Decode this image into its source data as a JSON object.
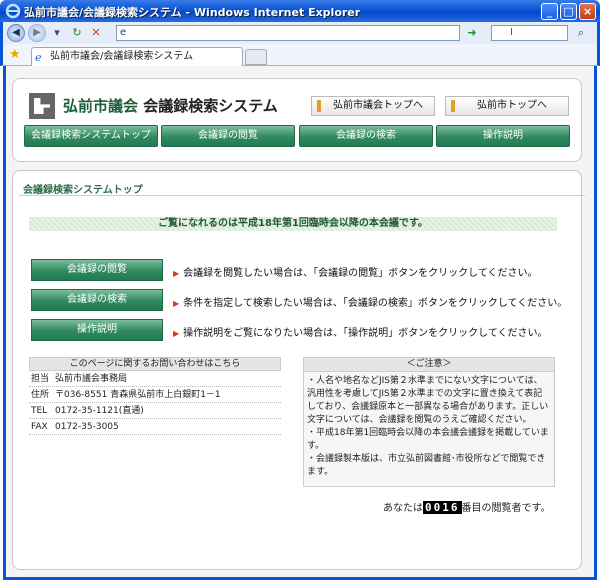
{
  "window": {
    "title": "弘前市議会/会議録検索システム - Windows Internet Explorer",
    "buttons": {
      "minimize": "_",
      "maximize": "□",
      "close": "×"
    }
  },
  "browser": {
    "address_value": "e",
    "search_placeholder": "I",
    "tab_label": "弘前市議会/会議録検索システム"
  },
  "header": {
    "site_name": "弘前市議会",
    "system_name": "会議録検索システム",
    "top_links": [
      {
        "label": "弘前市議会トップへ"
      },
      {
        "label": "弘前市トップへ"
      }
    ],
    "nav": [
      {
        "label": "会議録検索システムトップ"
      },
      {
        "label": "会議録の閲覧"
      },
      {
        "label": "会議録の検索"
      },
      {
        "label": "操作説明"
      }
    ]
  },
  "main": {
    "section_title": "会議録検索システムトップ",
    "banner": "ご覧になれるのは平成18年第1回臨時会以降の本会議です。",
    "actions": [
      {
        "label": "会議録の閲覧",
        "desc": "会議録を閲覧したい場合は、「会議録の閲覧」ボタンをクリックしてください。"
      },
      {
        "label": "会議録の検索",
        "desc": "条件を指定して検索したい場合は、「会議録の検索」ボタンをクリックしてください。"
      },
      {
        "label": "操作説明",
        "desc": "操作説明をご覧になりたい場合は、「操作説明」ボタンをクリックしてください。"
      }
    ],
    "contact": {
      "header": "このページに関するお問い合わせはこちら",
      "rows": [
        {
          "label": "担当",
          "value": "弘前市議会事務局"
        },
        {
          "label": "住所",
          "value": "〒036-8551 青森県弘前市上白銀町1－1"
        },
        {
          "label": "TEL",
          "value": "0172-35-1121(直通)"
        },
        {
          "label": "FAX",
          "value": "0172-35-3005"
        }
      ]
    },
    "notice": {
      "header": "＜ご注意＞",
      "items": [
        "・人名や地名などJIS第２水準までにない文字については、汎用性を考慮してJIS第２水準までの文字に置き換えて表記しており、会議録原本と一部異なる場合があります。正しい文字については、会議録を閲覧のうえご確認ください。",
        "・平成18年第1回臨時会以降の本会議会議録を掲載しています。",
        "・会議録製本版は、市立弘前図書館･市役所などで閲覧できます。"
      ]
    },
    "counter": {
      "prefix": "あなたは",
      "digits": "0016",
      "suffix": "番目の閲覧者です。"
    }
  }
}
